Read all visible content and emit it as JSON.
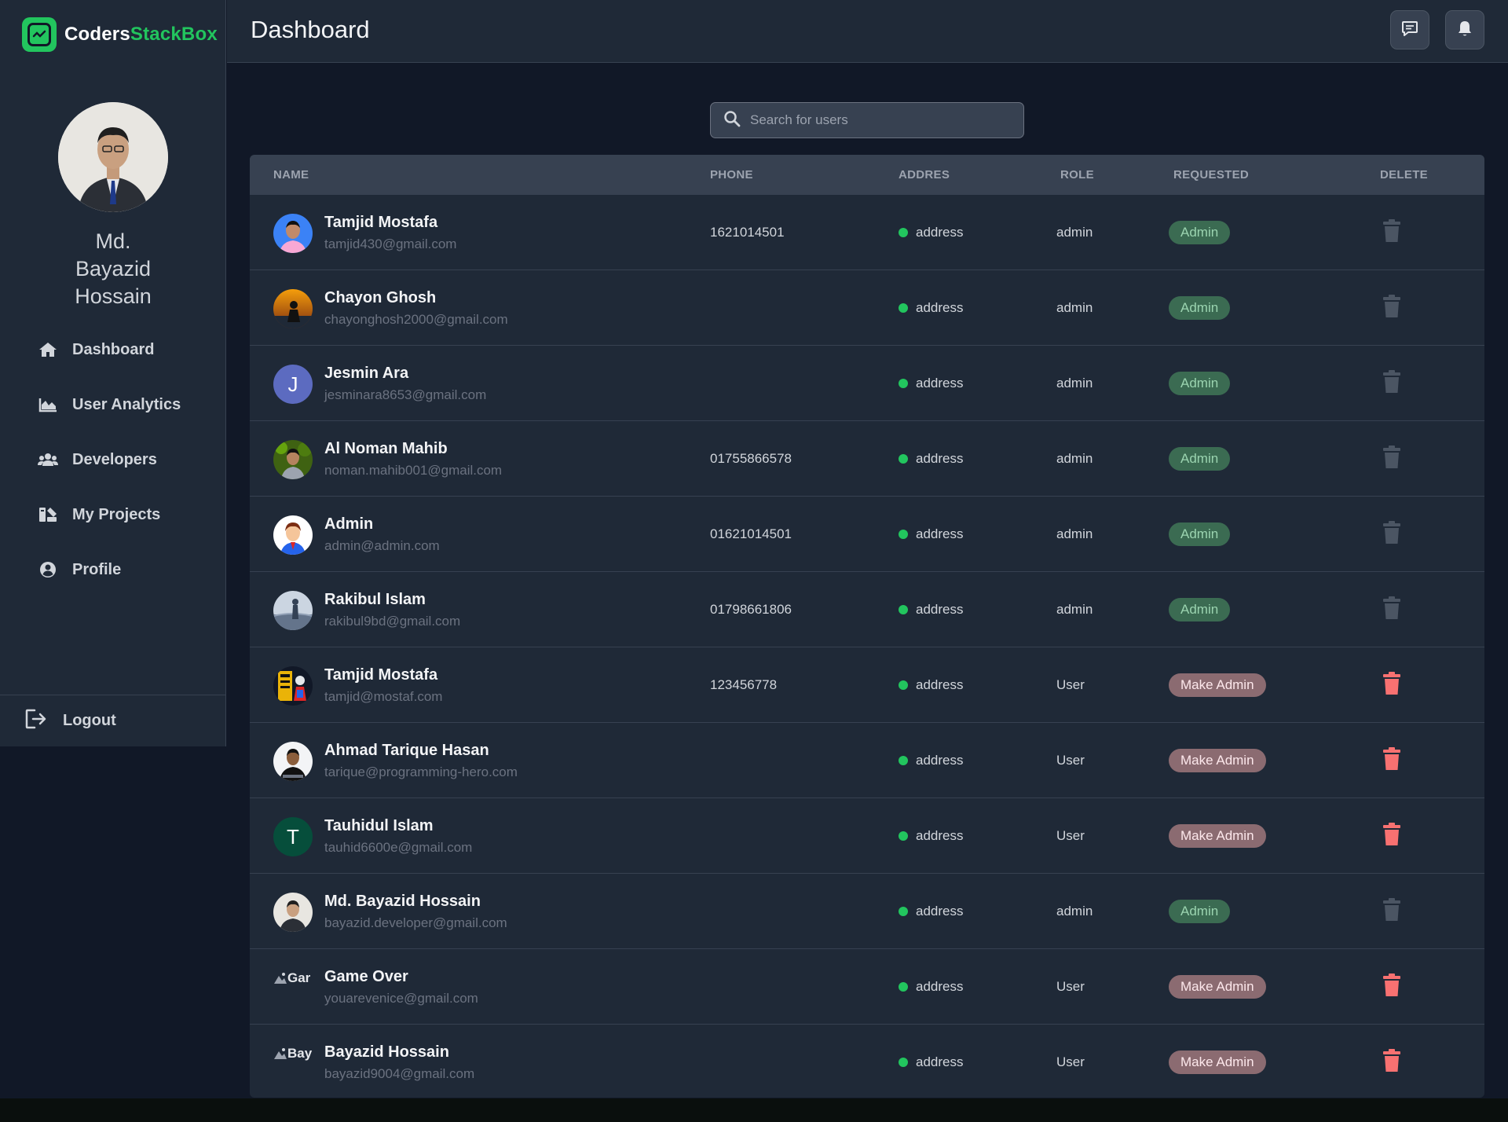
{
  "brand": {
    "name_a": "Coders",
    "name_b": "StackBox"
  },
  "sidebar": {
    "profile_name": "Md. Bayazid Hossain",
    "items": [
      {
        "label": "Dashboard",
        "icon": "home-icon"
      },
      {
        "label": "User Analytics",
        "icon": "chart-area-icon"
      },
      {
        "label": "Developers",
        "icon": "users-icon"
      },
      {
        "label": "My Projects",
        "icon": "projects-icon"
      },
      {
        "label": "Profile",
        "icon": "user-circle-icon"
      }
    ],
    "logout_label": "Logout"
  },
  "header": {
    "title": "Dashboard",
    "icons": [
      "message-icon",
      "bell-icon"
    ]
  },
  "search": {
    "placeholder": "Search for users"
  },
  "table": {
    "columns": [
      "NAME",
      "PHONE",
      "ADDRES",
      "ROLE",
      "REQUESTED",
      "DELETE"
    ],
    "rows": [
      {
        "name": "Tamjid Mostafa",
        "email": "tamjid430@gmail.com",
        "phone": "1621014501",
        "address": "address",
        "role": "admin",
        "requested": "Admin"
      },
      {
        "name": "Chayon Ghosh",
        "email": "chayonghosh2000@gmail.com",
        "phone": "",
        "address": "address",
        "role": "admin",
        "requested": "Admin"
      },
      {
        "name": "Jesmin Ara",
        "email": "jesminara8653@gmail.com",
        "phone": "",
        "address": "address",
        "role": "admin",
        "requested": "Admin",
        "avatar_letter": "J"
      },
      {
        "name": "Al Noman Mahib",
        "email": "noman.mahib001@gmail.com",
        "phone": "01755866578",
        "address": "address",
        "role": "admin",
        "requested": "Admin"
      },
      {
        "name": "Admin",
        "email": "admin@admin.com",
        "phone": "01621014501",
        "address": "address",
        "role": "admin",
        "requested": "Admin"
      },
      {
        "name": "Rakibul Islam",
        "email": "rakibul9bd@gmail.com",
        "phone": "01798661806",
        "address": "address",
        "role": "admin",
        "requested": "Admin"
      },
      {
        "name": "Tamjid Mostafa",
        "email": "tamjid@mostaf.com",
        "phone": "123456778",
        "address": "address",
        "role": "User",
        "requested": "Make Admin"
      },
      {
        "name": "Ahmad Tarique Hasan",
        "email": "tarique@programming-hero.com",
        "phone": "",
        "address": "address",
        "role": "User",
        "requested": "Make Admin"
      },
      {
        "name": "Tauhidul Islam",
        "email": "tauhid6600e@gmail.com",
        "phone": "",
        "address": "address",
        "role": "User",
        "requested": "Make Admin",
        "avatar_letter": "T"
      },
      {
        "name": "Md. Bayazid Hossain",
        "email": "bayazid.developer@gmail.com",
        "phone": "",
        "address": "address",
        "role": "admin",
        "requested": "Admin"
      },
      {
        "name": "Game Over",
        "email": "youarevenice@gmail.com",
        "phone": "",
        "address": "address",
        "role": "User",
        "requested": "Make Admin",
        "broken_alt": "Gar"
      },
      {
        "name": "Bayazid Hossain",
        "email": "bayazid9004@gmail.com",
        "phone": "",
        "address": "address",
        "role": "User",
        "requested": "Make Admin",
        "broken_alt": "Bay"
      }
    ]
  },
  "colors": {
    "accent": "#22c55e",
    "admin_badge": "#3b6b52",
    "make_admin_badge": "#8b6b71",
    "delete_active": "#f87171",
    "delete_disabled": "#4b5563"
  }
}
